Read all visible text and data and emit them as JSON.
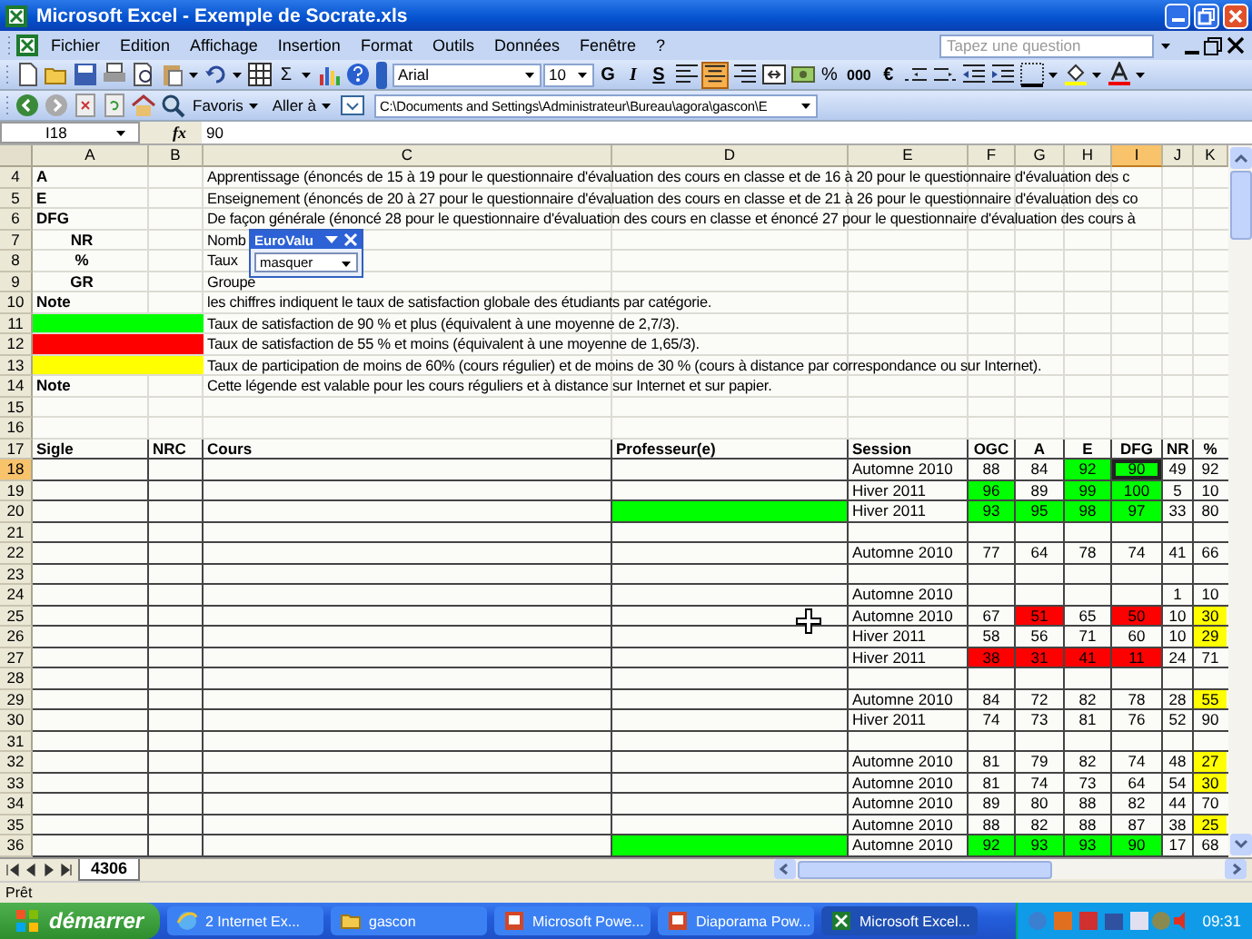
{
  "window": {
    "title": "Microsoft Excel - Exemple de Socrate.xls"
  },
  "menu": [
    "Fichier",
    "Edition",
    "Affichage",
    "Insertion",
    "Format",
    "Outils",
    "Données",
    "Fenêtre",
    "?"
  ],
  "help_search": {
    "placeholder": "Tapez une question"
  },
  "standard_toolbar": {
    "autosum": "Σ"
  },
  "formatting": {
    "font": "Arial",
    "size": "10",
    "bold": "G",
    "italic": "I",
    "underline": "S",
    "percent": "%",
    "thousands": "000",
    "currency": "€",
    "alignment": [
      {
        "selected": false
      },
      {
        "selected": true
      },
      {
        "selected": false
      },
      {
        "selected": false
      }
    ]
  },
  "web_toolbar": {
    "favorites": "Favoris",
    "go": "Aller à",
    "address": "C:\\Documents and Settings\\Administrateur\\Bureau\\agora\\gascon\\E"
  },
  "formula_bar": {
    "name_box": "I18",
    "fx": "fx",
    "formula": "90"
  },
  "columns": [
    {
      "label": "A",
      "selected": false
    },
    {
      "label": "B",
      "selected": false
    },
    {
      "label": "C",
      "selected": false
    },
    {
      "label": "D",
      "selected": false
    },
    {
      "label": "E",
      "selected": false
    },
    {
      "label": "F",
      "selected": false
    },
    {
      "label": "G",
      "selected": false
    },
    {
      "label": "H",
      "selected": false
    },
    {
      "label": "I",
      "selected": true
    },
    {
      "label": "J",
      "selected": false
    },
    {
      "label": "K",
      "selected": false
    }
  ],
  "legend_rows": [
    {
      "row": "4",
      "kind": "key",
      "label": "A",
      "text": "Apprentissage  (énoncés de 15 à 19 pour le questionnaire d'évaluation des cours en classe et de 16 à 20 pour le questionnaire d'évaluation des c"
    },
    {
      "row": "5",
      "kind": "key",
      "label": "E",
      "text": "Enseignement (énoncés de 20 à 27 pour le questionnaire d'évaluation des cours en classe et de 21 à 26 pour le questionnaire d'évaluation des co"
    },
    {
      "row": "6",
      "kind": "key",
      "label": "DFG",
      "text": "De façon générale (énoncé 28 pour le questionnaire d'évaluation des cours en classe et énoncé 27 pour le questionnaire d'évaluation des cours à"
    },
    {
      "row": "7",
      "kind": "sub",
      "label": "NR",
      "text": "Nomb"
    },
    {
      "row": "8",
      "kind": "sub",
      "label": "%",
      "text": "Taux"
    },
    {
      "row": "9",
      "kind": "sub",
      "label": "GR",
      "text": "Groupe"
    },
    {
      "row": "10",
      "kind": "key",
      "label": "Note",
      "text": "les chiffres indiquent le taux de satisfaction globale des étudiants par catégorie."
    },
    {
      "row": "11",
      "kind": "swatch",
      "color": "#00ff00",
      "text": "Taux de satisfaction de 90 % et plus (équivalent à une moyenne de 2,7/3)."
    },
    {
      "row": "12",
      "kind": "swatch",
      "color": "#ff0000",
      "text": "Taux de satisfaction de 55 % et moins (équivalent à une moyenne de 1,65/3)."
    },
    {
      "row": "13",
      "kind": "swatch",
      "color": "#ffff00",
      "text": "Taux de participation de moins de 60% (cours régulier) et de moins de 30 % (cours à distance par correspondance ou sur Internet)."
    },
    {
      "row": "14",
      "kind": "key",
      "label": "Note",
      "text": "Cette légende est valable pour les cours réguliers et à distance sur Internet et sur papier."
    },
    {
      "row": "15"
    },
    {
      "row": "16"
    }
  ],
  "table_header": {
    "row": "17",
    "cells": [
      "Sigle",
      "NRC",
      "Cours",
      "Professeur(e)",
      "Session",
      "OGC",
      "A",
      "E",
      "DFG",
      "NR",
      "%"
    ]
  },
  "rows": [
    {
      "row": "18",
      "selected": true,
      "session": "Automne 2010",
      "ogc": {
        "text": "88"
      },
      "a": {
        "text": "84"
      },
      "e": {
        "text": "92",
        "color": "#00ff00"
      },
      "dfg": {
        "text": "90",
        "color": "#00ff00"
      },
      "nr": {
        "text": "49"
      },
      "pct": {
        "text": "92"
      }
    },
    {
      "row": "19",
      "selected": false,
      "session": "Hiver 2011",
      "ogc": {
        "text": "96",
        "color": "#00ff00"
      },
      "a": {
        "text": "89"
      },
      "e": {
        "text": "99",
        "color": "#00ff00"
      },
      "dfg": {
        "text": "100",
        "color": "#00ff00"
      },
      "nr": {
        "text": "5"
      },
      "pct": {
        "text": "10"
      }
    },
    {
      "row": "20",
      "selected": false,
      "professor": {
        "color": "#00ff00"
      },
      "session": "Hiver 2011",
      "ogc": {
        "text": "93",
        "color": "#00ff00"
      },
      "a": {
        "text": "95",
        "color": "#00ff00"
      },
      "e": {
        "text": "98",
        "color": "#00ff00"
      },
      "dfg": {
        "text": "97",
        "color": "#00ff00"
      },
      "nr": {
        "text": "33"
      },
      "pct": {
        "text": "80"
      }
    },
    {
      "row": "21",
      "selected": false
    },
    {
      "row": "22",
      "selected": false,
      "session": "Automne 2010",
      "ogc": {
        "text": "77"
      },
      "a": {
        "text": "64"
      },
      "e": {
        "text": "78"
      },
      "dfg": {
        "text": "74"
      },
      "nr": {
        "text": "41"
      },
      "pct": {
        "text": "66"
      }
    },
    {
      "row": "23",
      "selected": false
    },
    {
      "row": "24",
      "selected": false,
      "session": "Automne 2010",
      "nr": {
        "text": "1"
      },
      "pct": {
        "text": "10"
      }
    },
    {
      "row": "25",
      "selected": false,
      "session": "Automne 2010",
      "ogc": {
        "text": "67"
      },
      "a": {
        "text": "51",
        "color": "#ff0000"
      },
      "e": {
        "text": "65"
      },
      "dfg": {
        "text": "50",
        "color": "#ff0000"
      },
      "nr": {
        "text": "10"
      },
      "pct": {
        "text": "30",
        "color": "#ffff00"
      }
    },
    {
      "row": "26",
      "selected": false,
      "session": "Hiver 2011",
      "ogc": {
        "text": "58"
      },
      "a": {
        "text": "56"
      },
      "e": {
        "text": "71"
      },
      "dfg": {
        "text": "60"
      },
      "nr": {
        "text": "10"
      },
      "pct": {
        "text": "29",
        "color": "#ffff00"
      }
    },
    {
      "row": "27",
      "selected": false,
      "session": "Hiver 2011",
      "ogc": {
        "text": "38",
        "color": "#ff0000"
      },
      "a": {
        "text": "31",
        "color": "#ff0000"
      },
      "e": {
        "text": "41",
        "color": "#ff0000"
      },
      "dfg": {
        "text": "11",
        "color": "#ff0000"
      },
      "nr": {
        "text": "24"
      },
      "pct": {
        "text": "71"
      }
    },
    {
      "row": "28",
      "selected": false
    },
    {
      "row": "29",
      "selected": false,
      "session": "Automne 2010",
      "ogc": {
        "text": "84"
      },
      "a": {
        "text": "72"
      },
      "e": {
        "text": "82"
      },
      "dfg": {
        "text": "78"
      },
      "nr": {
        "text": "28"
      },
      "pct": {
        "text": "55",
        "color": "#ffff00"
      }
    },
    {
      "row": "30",
      "selected": false,
      "session": "Hiver 2011",
      "ogc": {
        "text": "74"
      },
      "a": {
        "text": "73"
      },
      "e": {
        "text": "81"
      },
      "dfg": {
        "text": "76"
      },
      "nr": {
        "text": "52"
      },
      "pct": {
        "text": "90"
      }
    },
    {
      "row": "31",
      "selected": false
    },
    {
      "row": "32",
      "selected": false,
      "session": "Automne 2010",
      "ogc": {
        "text": "81"
      },
      "a": {
        "text": "79"
      },
      "e": {
        "text": "82"
      },
      "dfg": {
        "text": "74"
      },
      "nr": {
        "text": "48"
      },
      "pct": {
        "text": "27",
        "color": "#ffff00"
      }
    },
    {
      "row": "33",
      "selected": false,
      "session": "Automne 2010",
      "ogc": {
        "text": "81"
      },
      "a": {
        "text": "74"
      },
      "e": {
        "text": "73"
      },
      "dfg": {
        "text": "64"
      },
      "nr": {
        "text": "54"
      },
      "pct": {
        "text": "30",
        "color": "#ffff00"
      }
    },
    {
      "row": "34",
      "selected": false,
      "session": "Automne 2010",
      "ogc": {
        "text": "89"
      },
      "a": {
        "text": "80"
      },
      "e": {
        "text": "88"
      },
      "dfg": {
        "text": "82"
      },
      "nr": {
        "text": "44"
      },
      "pct": {
        "text": "70"
      }
    },
    {
      "row": "35",
      "selected": false,
      "session": "Automne 2010",
      "ogc": {
        "text": "88"
      },
      "a": {
        "text": "82"
      },
      "e": {
        "text": "88"
      },
      "dfg": {
        "text": "87"
      },
      "nr": {
        "text": "38"
      },
      "pct": {
        "text": "25",
        "color": "#ffff00"
      }
    },
    {
      "row": "36",
      "selected": false,
      "professor": {
        "color": "#00ff00"
      },
      "session": "Automne 2010",
      "ogc": {
        "text": "92",
        "color": "#00ff00"
      },
      "a": {
        "text": "93",
        "color": "#00ff00"
      },
      "e": {
        "text": "93",
        "color": "#00ff00"
      },
      "dfg": {
        "text": "90",
        "color": "#00ff00"
      },
      "nr": {
        "text": "17"
      },
      "pct": {
        "text": "68"
      }
    }
  ],
  "floating_toolbar": {
    "title": "EuroValu",
    "value": "masquer"
  },
  "sheet_tabs": [
    {
      "label": "4306",
      "selected": true
    }
  ],
  "status_bar": "Prêt",
  "taskbar": {
    "start": "démarrer",
    "buttons": [
      {
        "label": "2 Internet Ex...",
        "kind": "browser",
        "selected": false
      },
      {
        "label": "gascon",
        "kind": "folder",
        "selected": false
      },
      {
        "label": "Microsoft Powe...",
        "kind": "slides",
        "selected": false
      },
      {
        "label": "Diaporama Pow...",
        "kind": "slides",
        "selected": false
      },
      {
        "label": "Microsoft Excel...",
        "kind": "sheet",
        "selected": true
      }
    ],
    "clock": "09:31"
  }
}
